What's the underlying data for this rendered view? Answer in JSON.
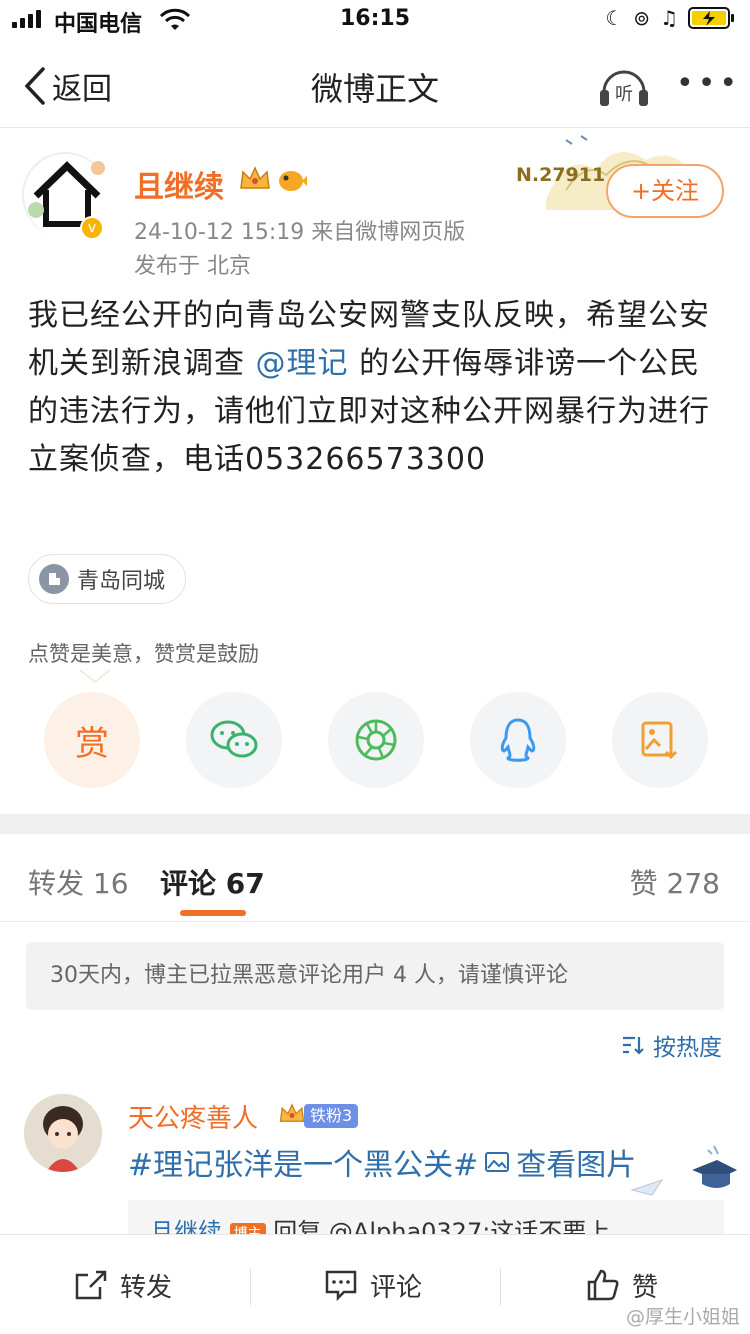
{
  "status_bar": {
    "carrier": "中国电信",
    "time": "16:15"
  },
  "nav": {
    "back_label": "返回",
    "title": "微博正文",
    "listen_label": "听",
    "more_label": "•••"
  },
  "post": {
    "author": "且继续",
    "badge_number": "N.27911",
    "follow_label": "+关注",
    "datetime_source": "24-10-12 15:19  来自微博网页版",
    "location": "发布于 北京",
    "text_before": "我已经公开的向青岛公安网警支队反映，希望公安机关到新浪调查 ",
    "mention": "@理记",
    "text_after": " 的公开侮辱诽谤一个公民的违法行为，请他们立即对这种公开网暴行为进行立案侦查，电话053266573300",
    "city_tag": "青岛同城",
    "reward_tip": "点赞是美意，赞赏是鼓励",
    "reward_label": "赏"
  },
  "tabs": {
    "repost_label": "转发",
    "repost_count": "16",
    "comment_label": "评论",
    "comment_count": "67",
    "like_label": "赞",
    "like_count": "278"
  },
  "notice": "30天内，博主已拉黑恶意评论用户 4 人，请谨慎评论",
  "sort_label": "按热度",
  "comment": {
    "name": "天公疼善人",
    "fan_badge": "铁粉3",
    "topic": "#理记张洋是一个黑公关#",
    "view_image": "查看图片",
    "reply_author": "且继续",
    "reply_tag": "博主",
    "reply_text": "回复 @Alpha0327:这话不要上"
  },
  "bottom_bar": {
    "repost": "转发",
    "comment": "评论",
    "like": "赞"
  },
  "watermark": "@厚生小姐姐"
}
